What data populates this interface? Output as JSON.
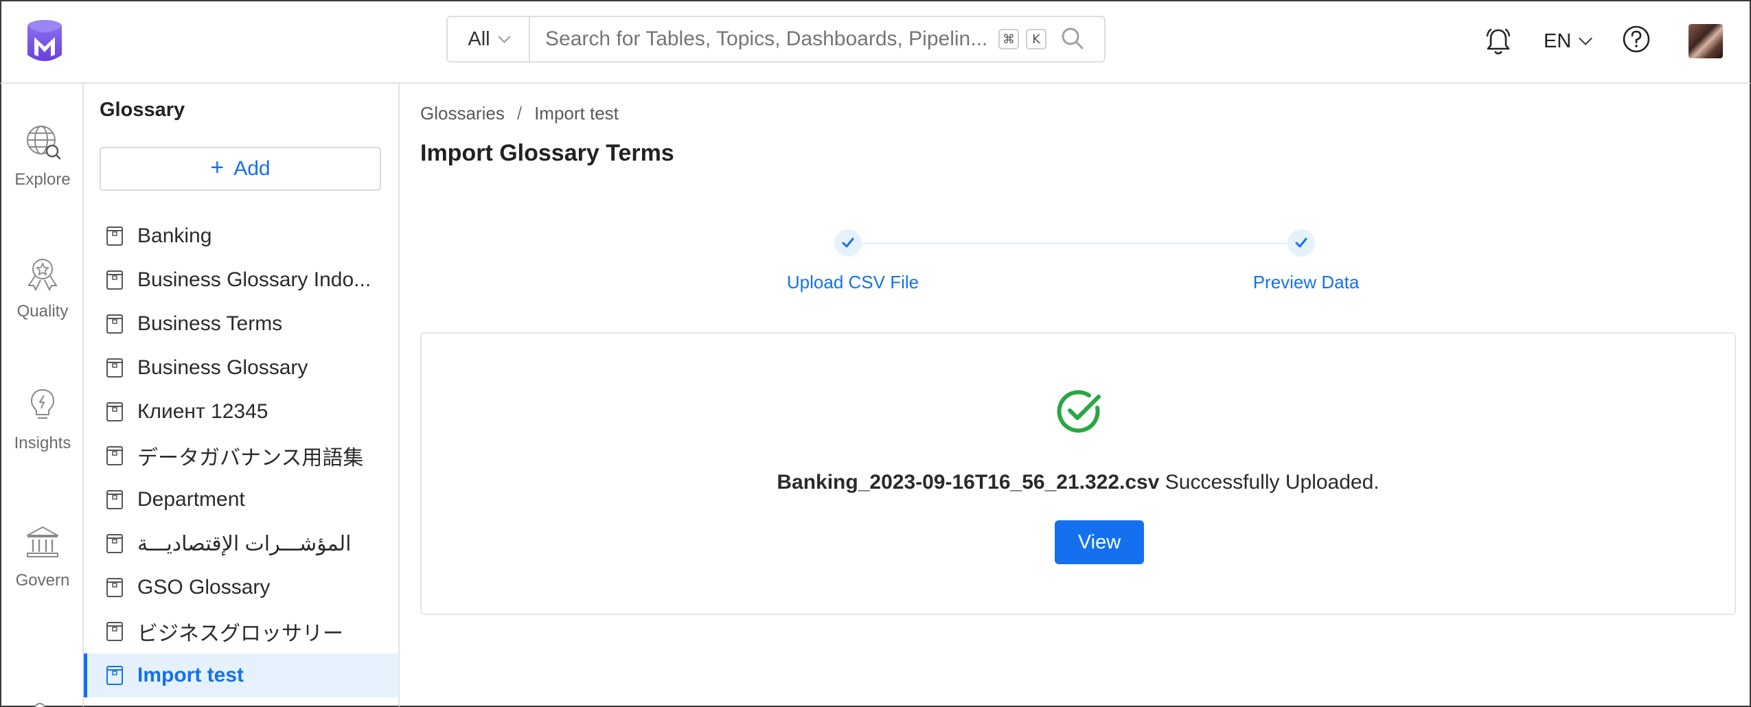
{
  "header": {
    "search": {
      "category": "All",
      "placeholder": "Search for Tables, Topics, Dashboards, Pipelin...",
      "shortcut_cmd": "⌘",
      "shortcut_key": "K"
    },
    "language": "EN"
  },
  "leftnav": {
    "items": [
      {
        "label": "Explore",
        "icon": "explore-icon"
      },
      {
        "label": "Quality",
        "icon": "quality-icon"
      },
      {
        "label": "Insights",
        "icon": "insights-icon"
      },
      {
        "label": "Govern",
        "icon": "govern-icon"
      }
    ]
  },
  "glossary_panel": {
    "title": "Glossary",
    "add_plus": "+",
    "add_label": "Add",
    "items": [
      {
        "label": "Banking"
      },
      {
        "label": "Business Glossary Indo..."
      },
      {
        "label": "Business Terms"
      },
      {
        "label": "Business Glossary"
      },
      {
        "label": "Клиент 12345"
      },
      {
        "label": "データガバナンス用語集"
      },
      {
        "label": "Department"
      },
      {
        "label": "المؤشـــرات الإقتصاديـــة"
      },
      {
        "label": "GSO Glossary"
      },
      {
        "label": "ビジネスグロッサリー"
      },
      {
        "label": "Import test"
      }
    ],
    "active_index": 10
  },
  "main": {
    "breadcrumb": {
      "root": "Glossaries",
      "separator": "/",
      "current": "Import test"
    },
    "title": "Import Glossary Terms",
    "steps": [
      {
        "label": "Upload CSV File",
        "status": "completed"
      },
      {
        "label": "Preview Data",
        "status": "completed"
      }
    ],
    "result": {
      "file_name": "Banking_2023-09-16T16_56_21.322.csv",
      "message": "Successfully Uploaded.",
      "view_label": "View"
    }
  },
  "colors": {
    "accent": "#1470ef",
    "success": "#28a745",
    "active_bg": "#e5f2fd"
  }
}
